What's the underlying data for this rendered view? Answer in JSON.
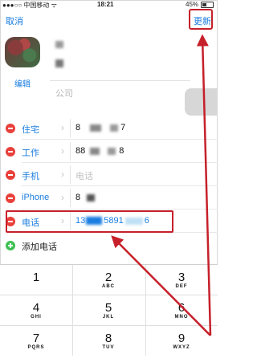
{
  "status_bar": {
    "carrier": "●●●○○ 中国移动 ᯤ",
    "time": "18:21",
    "battery": "45%"
  },
  "nav": {
    "cancel": "取消",
    "update": "更新"
  },
  "header": {
    "edit": "编辑",
    "company_placeholder": "公司"
  },
  "phones": [
    {
      "label": "住宅",
      "value_start": "8",
      "value_mid": "",
      "value_end": "7"
    },
    {
      "label": "工作",
      "value_start": "88",
      "value_mid": "",
      "value_end": "8"
    },
    {
      "label": "手机",
      "placeholder": "电话"
    },
    {
      "label": "iPhone",
      "value_start": "8",
      "value_mid": "",
      "value_end": ""
    },
    {
      "label": "电话",
      "value_start": "13",
      "value_mid": "5891",
      "value_end": "6"
    }
  ],
  "add_phone": "添加电话",
  "keypad": [
    {
      "num": "1",
      "letters": ""
    },
    {
      "num": "2",
      "letters": "ABC"
    },
    {
      "num": "3",
      "letters": "DEF"
    },
    {
      "num": "4",
      "letters": "GHI"
    },
    {
      "num": "5",
      "letters": "JKL"
    },
    {
      "num": "6",
      "letters": "MNO"
    },
    {
      "num": "7",
      "letters": "PQRS"
    },
    {
      "num": "8",
      "letters": "TUV"
    },
    {
      "num": "9",
      "letters": "WXYZ"
    }
  ],
  "colors": {
    "accent": "#1a7de0",
    "annotation": "#c6202a",
    "delete": "#e9403b",
    "add": "#3fc052"
  }
}
